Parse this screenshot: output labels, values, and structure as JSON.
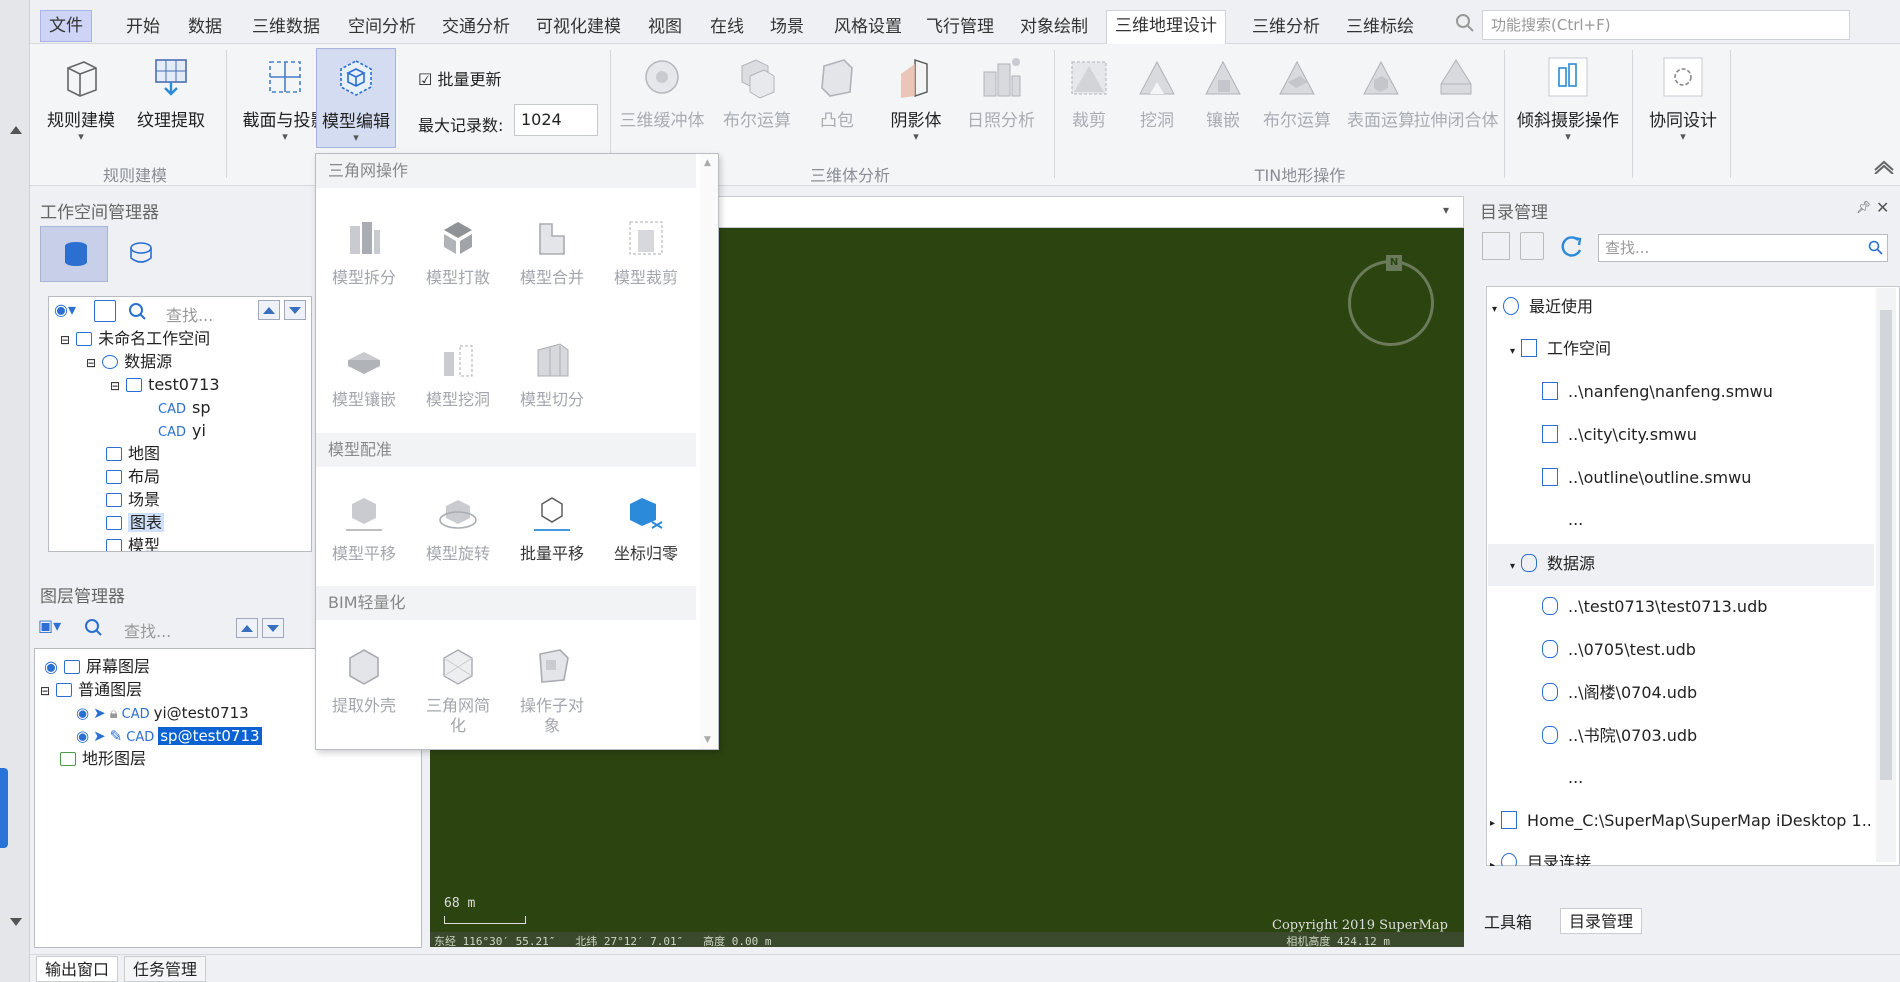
{
  "menu": {
    "file": "文件",
    "items": [
      "开始",
      "数据",
      "三维数据",
      "空间分析",
      "交通分析",
      "可视化建模",
      "视图",
      "在线",
      "场景",
      "风格设置",
      "飞行管理",
      "对象绘制",
      "三维地理设计",
      "三维分析",
      "三维标绘"
    ],
    "active_index": 12,
    "search_placeholder": "功能搜索(Ctrl+F)"
  },
  "ribbon": {
    "rule_model": "规则建模",
    "texture": "纹理提取",
    "group_rule": "规则建模",
    "section_proj": "截面与投影",
    "model_edit": "模型编辑",
    "batch_update": "批量更新",
    "max_records_label": "最大记录数:",
    "max_records_value": "1024",
    "buffer": "三维缓冲体",
    "boolean": "布尔运算",
    "convex": "凸包",
    "shadow": "阴影体",
    "sunlight": "日照分析",
    "group_3d": "三维体分析",
    "clip": "裁剪",
    "dig": "挖洞",
    "inlay": "镶嵌",
    "tin_boolean": "布尔运算",
    "surface": "表面运算",
    "extrude": "拉伸闭合体",
    "group_tin": "TIN地形操作",
    "oblique": "倾斜摄影操作",
    "collab": "协同设计"
  },
  "dropdown": {
    "sec1": "三角网操作",
    "sec1_items": [
      "模型拆分",
      "模型打散",
      "模型合并",
      "模型裁剪",
      "模型镶嵌",
      "模型挖洞",
      "模型切分"
    ],
    "sec2": "模型配准",
    "sec2_items": [
      "模型平移",
      "模型旋转",
      "批量平移",
      "坐标归零"
    ],
    "sec3": "BIM轻量化",
    "sec3_items": [
      "提取外壳",
      "三角网简\n化",
      "操作子对\n象"
    ]
  },
  "workspace": {
    "title": "工作空间管理器",
    "search": "查找...",
    "tree": {
      "root": "未命名工作空间",
      "datasource": "数据源",
      "ds": "test0713",
      "d1": "sp",
      "d2": "yi",
      "map": "地图",
      "layout": "布局",
      "scene": "场景",
      "chart": "图表",
      "model": "模型"
    }
  },
  "layers": {
    "title": "图层管理器",
    "search": "查找...",
    "screen": "屏幕图层",
    "normal": "普通图层",
    "l1": "yi@test0713",
    "l2": "sp@test0713",
    "terrain": "地形图层"
  },
  "map": {
    "scale": "68 m",
    "copyright": "Copyright 2019 SuperMap",
    "coords": "东经 116°30′ 55.21″   北纬 27°12′ 7.01″   高度 0.00 m",
    "camera": "相机高度 424.12 m",
    "north": "N",
    "bg": "#2c4410"
  },
  "catalog": {
    "title": "目录管理",
    "search": "查找...",
    "recent": "最近使用",
    "workspace": "工作空间",
    "w1": "..\\nanfeng\\nanfeng.smwu",
    "w2": "..\\city\\city.smwu",
    "w3": "..\\outline\\outline.smwu",
    "w4": "...",
    "datasource": "数据源",
    "d1": "..\\test0713\\test0713.udb",
    "d2": "..\\0705\\test.udb",
    "d3": "..\\阁楼\\0704.udb",
    "d4": "..\\书院\\0703.udb",
    "d5": "...",
    "home": "Home_C:\\SuperMap\\SuperMap iDesktop 1...",
    "conn": "目录连接",
    "tab_tools": "工具箱",
    "tab_catalog": "目录管理"
  },
  "bottom": {
    "output": "输出窗口",
    "tasks": "任务管理"
  }
}
